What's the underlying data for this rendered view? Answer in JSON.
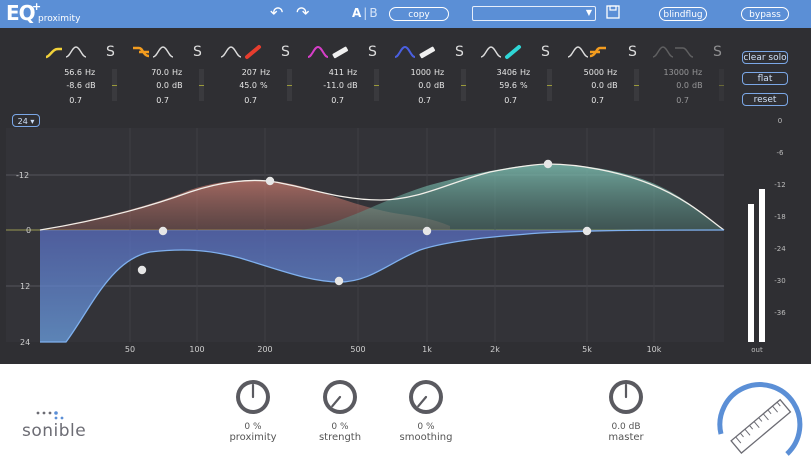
{
  "app": {
    "logo_letters": "EQ",
    "name": "proximity"
  },
  "toolbar": {
    "undo_icon": "undo-icon",
    "redo_icon": "redo-icon",
    "ab_a": "A",
    "ab_b": "B",
    "copy_label": "copy",
    "preset_value": "",
    "save_icon": "save-icon",
    "blindflug_label": "blindflug",
    "bypass_label": "bypass"
  },
  "bands": [
    {
      "freq": "56.6",
      "freq_unit": "Hz",
      "gain": "-8.6",
      "gain_unit": "dB",
      "q": "0.7",
      "solo": "S",
      "color": "#f1d13a",
      "shape": "low-shelf"
    },
    {
      "freq": "70.0",
      "freq_unit": "Hz",
      "gain": "0.0",
      "gain_unit": "dB",
      "q": "0.7",
      "solo": "S",
      "color": "#f39c1f",
      "shape": "low-cut"
    },
    {
      "freq": "207",
      "freq_unit": "Hz",
      "gain": "45.0",
      "gain_unit": "%",
      "q": "0.7",
      "solo": "S",
      "color": "#e63d2e",
      "shape": "proximity"
    },
    {
      "freq": "411",
      "freq_unit": "Hz",
      "gain": "-11.0",
      "gain_unit": "dB",
      "q": "0.7",
      "solo": "S",
      "color": "#d63ec8",
      "shape": "bell"
    },
    {
      "freq": "1000",
      "freq_unit": "Hz",
      "gain": "0.0",
      "gain_unit": "dB",
      "q": "0.7",
      "solo": "S",
      "color": "#4a5fe0",
      "shape": "bell"
    },
    {
      "freq": "3406",
      "freq_unit": "Hz",
      "gain": "59.6",
      "gain_unit": "%",
      "q": "0.7",
      "solo": "S",
      "color": "#2fd6d6",
      "shape": "proximity"
    },
    {
      "freq": "5000",
      "freq_unit": "Hz",
      "gain": "0.0",
      "gain_unit": "dB",
      "q": "0.7",
      "solo": "S",
      "color": "#f39c1f",
      "shape": "high-cut"
    },
    {
      "freq": "13000",
      "freq_unit": "Hz",
      "gain": "0.0",
      "gain_unit": "dB",
      "q": "0.7",
      "solo": "S",
      "color": "#888888",
      "shape": "high-shelf"
    }
  ],
  "right_buttons": {
    "clear_solo": "clear solo",
    "flat": "flat",
    "reset": "reset"
  },
  "zoom": {
    "value": "24",
    "arrow": "▾"
  },
  "graph": {
    "y_labels": [
      "-12",
      "0",
      "12",
      "24"
    ],
    "x_labels": [
      "50",
      "100",
      "200",
      "500",
      "1k",
      "2k",
      "5k",
      "10k"
    ],
    "meter_scale": [
      "0",
      "-6",
      "-12",
      "-18",
      "-24",
      "-30",
      "-36"
    ],
    "meter_label": "out",
    "meter_levels": [
      0.62,
      0.69
    ]
  },
  "knobs": [
    {
      "value": "0 %",
      "label": "proximity"
    },
    {
      "value": "0 %",
      "label": "strength"
    },
    {
      "value": "0 %",
      "label": "smoothing"
    },
    {
      "value": "0.0 dB",
      "label": "master"
    }
  ],
  "brand": {
    "name": "sonible"
  }
}
